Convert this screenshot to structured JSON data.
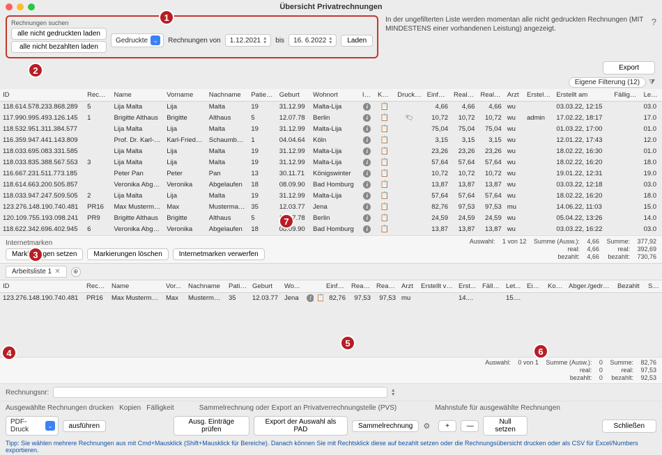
{
  "window": {
    "title": "Übersicht Privatrechnungen"
  },
  "search": {
    "group_label": "Rechnungen suchen",
    "btn_unprinted": "alle nicht gedruckten laden",
    "btn_unpaid": "alle nicht bezahlten laden",
    "type_select": "Gedruckte",
    "range_label_pre": "Rechnungen von",
    "date_from": "1.12.2021",
    "range_label_mid": "bis",
    "date_to": "16.  6.2022",
    "load_btn": "Laden"
  },
  "infotext": "In der ungefilterten Liste werden momentan alle nicht gedruckten Rechnungen (MIT MINDESTENS einer vorhandenen Leistung) angezeigt.",
  "help": "?",
  "export_btn": "Export",
  "filter_btn": "Eigene Filterung (12)",
  "main_table": {
    "cols": [
      "ID",
      "Rechn...",
      "Name",
      "Vorname",
      "Nachname",
      "Patient...",
      "Geburt",
      "Wohnort",
      "Info",
      "Kartei",
      "Druckdatei",
      "Einfac...",
      "Realbe...",
      "RealPl...",
      "Arzt",
      "Erstellt...",
      "Erstellt am",
      "Fällig bis",
      "Letzte..."
    ],
    "rows": [
      {
        "id": "118.614.578.233.868.289",
        "rechn": "5",
        "name": "Lija Malta",
        "vor": "Lija",
        "nach": "Malta",
        "pat": "19",
        "geb": "31.12.99",
        "ort": "Malta-Lija",
        "info": true,
        "kartei": true,
        "druck": "",
        "einf": "4,66",
        "realb": "4,66",
        "realp": "4,66",
        "arzt": "wu",
        "von": "",
        "am": "03.03.22, 12:15",
        "bis": "",
        "letzte": "03.0"
      },
      {
        "id": "117.990.995.493.126.145",
        "rechn": "1",
        "name": "Brigitte Althaus",
        "vor": "Brigitte",
        "nach": "Althaus",
        "pat": "5",
        "geb": "12.07.78",
        "ort": "Berlin",
        "info": true,
        "kartei": true,
        "druck": "tag",
        "einf": "10,72",
        "realb": "10,72",
        "realp": "10,72",
        "arzt": "wu",
        "von": "admin",
        "am": "17.02.22, 18:17",
        "bis": "",
        "letzte": "17.0"
      },
      {
        "id": "118.532.951.311.384.577",
        "rechn": "",
        "name": "Lija Malta",
        "vor": "Lija",
        "nach": "Malta",
        "pat": "19",
        "geb": "31.12.99",
        "ort": "Malta-Lija",
        "info": true,
        "kartei": true,
        "druck": "",
        "einf": "75,04",
        "realb": "75,04",
        "realp": "75,04",
        "arzt": "wu",
        "von": "",
        "am": "01.03.22, 17:00",
        "bis": "",
        "letzte": "01.0"
      },
      {
        "id": "116.359.947.441.143.809",
        "rechn": "",
        "name": "Prof. Dr. Karl-Fri...",
        "vor": "Karl-Friede...",
        "nach": "Schaumberg",
        "pat": "1",
        "geb": "04.04.64",
        "ort": "Köln",
        "info": true,
        "kartei": true,
        "druck": "",
        "einf": "3,15",
        "realb": "3,15",
        "realp": "3,15",
        "arzt": "wu",
        "von": "",
        "am": "12.01.22, 17:43",
        "bis": "",
        "letzte": "12.0"
      },
      {
        "id": "118.033.695.083.331.585",
        "rechn": "",
        "name": "Lija Malta",
        "vor": "Lija",
        "nach": "Malta",
        "pat": "19",
        "geb": "31.12.99",
        "ort": "Malta-Lija",
        "info": true,
        "kartei": true,
        "druck": "",
        "einf": "23,26",
        "realb": "23,26",
        "realp": "23,26",
        "arzt": "wu",
        "von": "",
        "am": "18.02.22, 16:30",
        "bis": "",
        "letzte": "01.0"
      },
      {
        "id": "118.033.835.388.567.553",
        "rechn": "3",
        "name": "Lija Malta",
        "vor": "Lija",
        "nach": "Malta",
        "pat": "19",
        "geb": "31.12.99",
        "ort": "Malta-Lija",
        "info": true,
        "kartei": true,
        "druck": "",
        "einf": "57,64",
        "realb": "57,64",
        "realp": "57,64",
        "arzt": "wu",
        "von": "",
        "am": "18.02.22, 16:20",
        "bis": "",
        "letzte": "18.0"
      },
      {
        "id": "116.667.231.511.773.185",
        "rechn": "",
        "name": "Peter Pan",
        "vor": "Peter",
        "nach": "Pan",
        "pat": "13",
        "geb": "30.11.71",
        "ort": "Königswinter",
        "info": true,
        "kartei": true,
        "druck": "",
        "einf": "10,72",
        "realb": "10,72",
        "realp": "10,72",
        "arzt": "wu",
        "von": "",
        "am": "19.01.22, 12:31",
        "bis": "",
        "letzte": "19.0"
      },
      {
        "id": "118.614.663.200.505.857",
        "rechn": "",
        "name": "Veronika Abgela...",
        "vor": "Veronika",
        "nach": "Abgelaufen",
        "pat": "18",
        "geb": "08.09.90",
        "ort": "Bad Homburg",
        "info": true,
        "kartei": true,
        "druck": "",
        "einf": "13,87",
        "realb": "13,87",
        "realp": "13,87",
        "arzt": "wu",
        "von": "",
        "am": "03.03.22, 12:18",
        "bis": "",
        "letzte": "03.0"
      },
      {
        "id": "118.033.947.247.509.505",
        "rechn": "2",
        "name": "Lija Malta",
        "vor": "Lija",
        "nach": "Malta",
        "pat": "19",
        "geb": "31.12.99",
        "ort": "Malta-Lija",
        "info": true,
        "kartei": true,
        "druck": "",
        "einf": "57,64",
        "realb": "57,64",
        "realp": "57,64",
        "arzt": "wu",
        "von": "",
        "am": "18.02.22, 16:20",
        "bis": "",
        "letzte": "18.0"
      },
      {
        "id": "123.276.148.190.740.481",
        "rechn": "PR16",
        "name": "Max Mustermann",
        "vor": "Max",
        "nach": "Mustermann",
        "pat": "35",
        "geb": "12.03.77",
        "ort": "Jena",
        "info": true,
        "kartei": true,
        "druck": "",
        "einf": "82,76",
        "realb": "97,53",
        "realp": "97,53",
        "arzt": "mu",
        "von": "",
        "am": "14.06.22, 11:03",
        "bis": "",
        "letzte": "15.0"
      },
      {
        "id": "120.109.755.193.098.241",
        "rechn": "PR9",
        "name": "Brigitte Althaus",
        "vor": "Brigitte",
        "nach": "Althaus",
        "pat": "5",
        "geb": "12.07.78",
        "ort": "Berlin",
        "info": true,
        "kartei": true,
        "druck": "",
        "einf": "24,59",
        "realb": "24,59",
        "realp": "24,59",
        "arzt": "wu",
        "von": "",
        "am": "05.04.22, 13:26",
        "bis": "",
        "letzte": "14.0"
      },
      {
        "id": "118.622.342.696.402.945",
        "rechn": "6",
        "name": "Veronika Abgela...",
        "vor": "Veronika",
        "nach": "Abgelaufen",
        "pat": "18",
        "geb": "08.09.90",
        "ort": "Bad Homburg",
        "info": true,
        "kartei": true,
        "druck": "",
        "einf": "13,87",
        "realb": "13,87",
        "realp": "13,87",
        "arzt": "wu",
        "von": "",
        "am": "03.03.22, 16:22",
        "bis": "",
        "letzte": "03.0"
      }
    ]
  },
  "markers": {
    "group_label": "Internetmarken",
    "set": "Markierungen setzen",
    "clear": "Markierungen löschen",
    "discard": "Internetmarken verwerfen"
  },
  "sums_upper": {
    "sel_label": "Auswahl:",
    "sel_val": "1 von 12",
    "c1a": "Summe (Ausw.):",
    "c1b": "real:",
    "c1c": "bezahlt:",
    "v1a": "4,66",
    "v1b": "4,66",
    "v1c": "4,66",
    "c2a": "Summe:",
    "c2b": "real:",
    "c2c": "bezahlt:",
    "v2a": "377,92",
    "v2b": "392,69",
    "v2c": "730,76"
  },
  "worklist": {
    "tab": "Arbeitsliste 1"
  },
  "lower_table": {
    "cols": [
      "ID",
      "Rech...",
      "Name",
      "Vor...",
      "Nachname",
      "Patie...",
      "Geburt",
      "Wo...",
      "",
      "",
      "Einfa...",
      "Realb...",
      "RealP...",
      "Arzt",
      "Erstellt von",
      "Erst...",
      "Fällig...",
      "Let...",
      "Einz...",
      "Kos...",
      "Abger./gedruckt",
      "Bezahlt",
      "St..."
    ],
    "row": {
      "id": "123.276.148.190.740.481",
      "rechn": "PR16",
      "name": "Max Mustermann",
      "vor": "Max",
      "nach": "Mustermann",
      "pat": "35",
      "geb": "12.03.77",
      "ort": "Jena",
      "einf": "82,76",
      "realb": "97,53",
      "realp": "97,53",
      "arzt": "mu",
      "am": "14....",
      "letzte": "15...."
    }
  },
  "sums_lower": {
    "sel_label": "Auswahl:",
    "sel_val": "0 von 1",
    "c1a": "Summe (Ausw.):",
    "c1b": "real:",
    "c1c": "bezahlt:",
    "v1a": "0",
    "v1b": "0",
    "v1c": "0",
    "c2a": "Summe:",
    "c2b": "real:",
    "c2c": "bezahlt:",
    "v2a": "82,76",
    "v2b": "97,53",
    "v2c": "92,53"
  },
  "rechnr_label": "Rechnungsnr:",
  "actions": {
    "print_sel": "Ausgewählte Rechnungen drucken",
    "copies": "Kopien",
    "due": "Fälligkeit",
    "pvs_label": "Sammelrechnung oder Export an Privatverrechnungstelle (PVS)",
    "pdf": "PDF-Druck",
    "run": "ausführen",
    "check": "Ausg. Einträge prüfen",
    "export_pad": "Export der Auswahl als PAD",
    "collect": "Sammelrechnung",
    "mahn": "Mahnstufe für ausgewählte Rechnungen",
    "plus": "+",
    "minus": "—",
    "nullset": "Null setzen",
    "close": "Schließen"
  },
  "tip": "Tipp: Sie wählen mehrere Rechnungen aus mit Cmd+Mausklick (Shift+Mausklick für Bereiche). Danach können Sie mit Rechtsklick diese auf bezahlt setzen oder die Rechnungsübersicht drucken oder als CSV für Excel/Numbers exportieren."
}
